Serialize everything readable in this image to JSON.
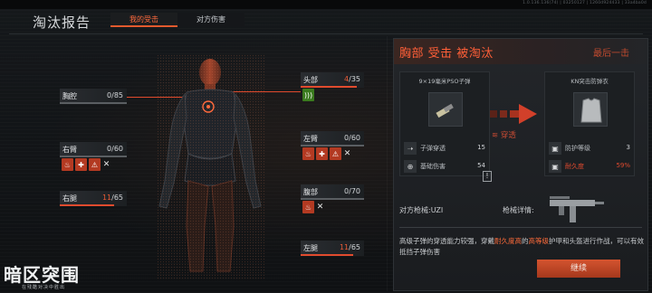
{
  "window": {
    "version_text": "1.0.136.136(74) | 03250127 | 1260d924433 | 33a4ba0d"
  },
  "header": {
    "title": "淘汰报告",
    "tabs": [
      {
        "label": "我的受击",
        "active": true
      },
      {
        "label": "对方伤害",
        "active": false
      }
    ]
  },
  "body_parts": {
    "chest": {
      "label": "胸腔",
      "current": "0",
      "max": "/85",
      "current_color": "#d6d9dc"
    },
    "head": {
      "label": "头部",
      "current": "4",
      "max": "/35",
      "current_color": "#e85a35"
    },
    "right_arm": {
      "label": "右臂",
      "current": "0",
      "max": "/60"
    },
    "left_arm": {
      "label": "左臂",
      "current": "0",
      "max": "/60"
    },
    "right_leg": {
      "label": "右腿",
      "current": "11",
      "max": "/65"
    },
    "abdomen": {
      "label": "腹部",
      "current": "0",
      "max": "/70"
    },
    "left_leg": {
      "label": "左腿",
      "current": "11",
      "max": "/65"
    }
  },
  "status_icons": {
    "head": [
      "hearing-icon"
    ],
    "right_arm": [
      "bleeding-icon",
      "fracture-icon",
      "pain-icon",
      "close-icon"
    ],
    "left_arm": [
      "bleeding-icon",
      "fracture-icon",
      "pain-icon",
      "close-icon"
    ],
    "abdomen": [
      "bleeding-icon",
      "close-icon"
    ]
  },
  "detail_panel": {
    "title": "胸部  受击  被淘汰",
    "last_hit": "最后一击",
    "ammo": {
      "caption": "9×19毫米PSO子弹",
      "rows": [
        {
          "icon": "bullet-penetration-icon",
          "label": "子弹穿透",
          "value": "15"
        },
        {
          "icon": "crosshair-icon",
          "label": "基础伤害",
          "value": "54"
        }
      ]
    },
    "armor": {
      "caption": "KN突击防弹衣",
      "rows": [
        {
          "icon": "vest-icon",
          "label": "防护等级",
          "value": "3"
        },
        {
          "icon": "vest-durability-icon",
          "label": "耐久度",
          "value": "59%"
        }
      ]
    },
    "penetration_text": "≋ 穿透",
    "info_mark": "!",
    "enemy_weapon_label": "对方枪械:UZI",
    "weapon_detail_label": "枪械详情:",
    "description": {
      "part1": "高级子弹的穿透能力较强，穿戴",
      "hl1": "耐久度高",
      "part2": "的",
      "hl2": "高等级",
      "part3": "护甲和头盔进行作战，可以有效抵挡子弹伤害"
    },
    "continue_label": "继续"
  },
  "logo": {
    "main": "暗区突围",
    "sub": "在残酷对决中胜出"
  },
  "colors": {
    "accent": "#e14b2e",
    "damage": "#e85a35",
    "highlight": "#ff6b3a"
  }
}
